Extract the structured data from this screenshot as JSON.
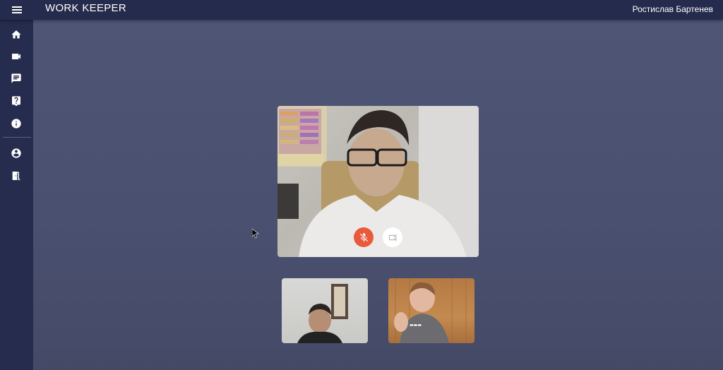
{
  "app": {
    "title": "WORK KEEPER",
    "user_name": "Ростислав Бартенев"
  },
  "colors": {
    "topbar": "#252b4c",
    "sidebar": "#262c4e",
    "main_bg": "#4a5070",
    "mute_button": "#e85a3c",
    "camera_button": "#ffffff"
  },
  "sidebar": {
    "items": [
      {
        "name": "home",
        "icon": "home-icon"
      },
      {
        "name": "video",
        "icon": "videocam-icon"
      },
      {
        "name": "chat",
        "icon": "chat-icon"
      },
      {
        "name": "help",
        "icon": "help-icon"
      },
      {
        "name": "info",
        "icon": "info-icon"
      },
      {
        "name": "account",
        "icon": "account-circle-icon"
      },
      {
        "name": "exit",
        "icon": "exit-door-icon"
      }
    ]
  },
  "call": {
    "main_participant": "main-video",
    "controls": [
      {
        "name": "mute",
        "icon": "mic-off-icon",
        "state": "muted"
      },
      {
        "name": "camera",
        "icon": "videocam-icon",
        "state": "on"
      }
    ],
    "participants": [
      {
        "name": "participant-1"
      },
      {
        "name": "participant-2"
      }
    ]
  }
}
